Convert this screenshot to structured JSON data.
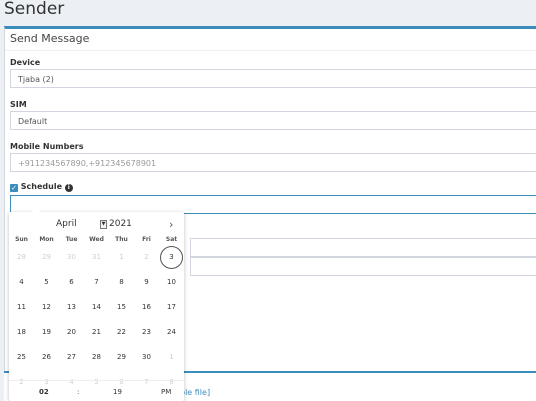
{
  "page": {
    "title": "Sender"
  },
  "card": {
    "title": "Send Message"
  },
  "device": {
    "label": "Device",
    "value": "Tjaba (2)"
  },
  "sim": {
    "label": "SIM",
    "value": "Default"
  },
  "mobile": {
    "label": "Mobile Numbers",
    "placeholder": "+911234567890,+912345678901"
  },
  "schedule": {
    "label": "Schedule",
    "checked": true,
    "value": ""
  },
  "footer": {
    "link_fragment": "ple file]"
  },
  "datepicker": {
    "month": "April",
    "year": "2021",
    "weekdays": [
      "Sun",
      "Mon",
      "Tue",
      "Wed",
      "Thu",
      "Fri",
      "Sat"
    ],
    "weeks": [
      [
        "28",
        "29",
        "30",
        "31",
        "1",
        "2",
        "3"
      ],
      [
        "4",
        "5",
        "6",
        "7",
        "8",
        "9",
        "10"
      ],
      [
        "11",
        "12",
        "13",
        "14",
        "15",
        "16",
        "17"
      ],
      [
        "18",
        "19",
        "20",
        "21",
        "22",
        "23",
        "24"
      ],
      [
        "25",
        "26",
        "27",
        "28",
        "29",
        "30",
        "1"
      ],
      [
        "2",
        "3",
        "4",
        "5",
        "6",
        "7",
        "8"
      ]
    ],
    "today": "3",
    "time": {
      "hour": "02",
      "separator": ":",
      "minute": "19",
      "ampm": "PM"
    }
  }
}
